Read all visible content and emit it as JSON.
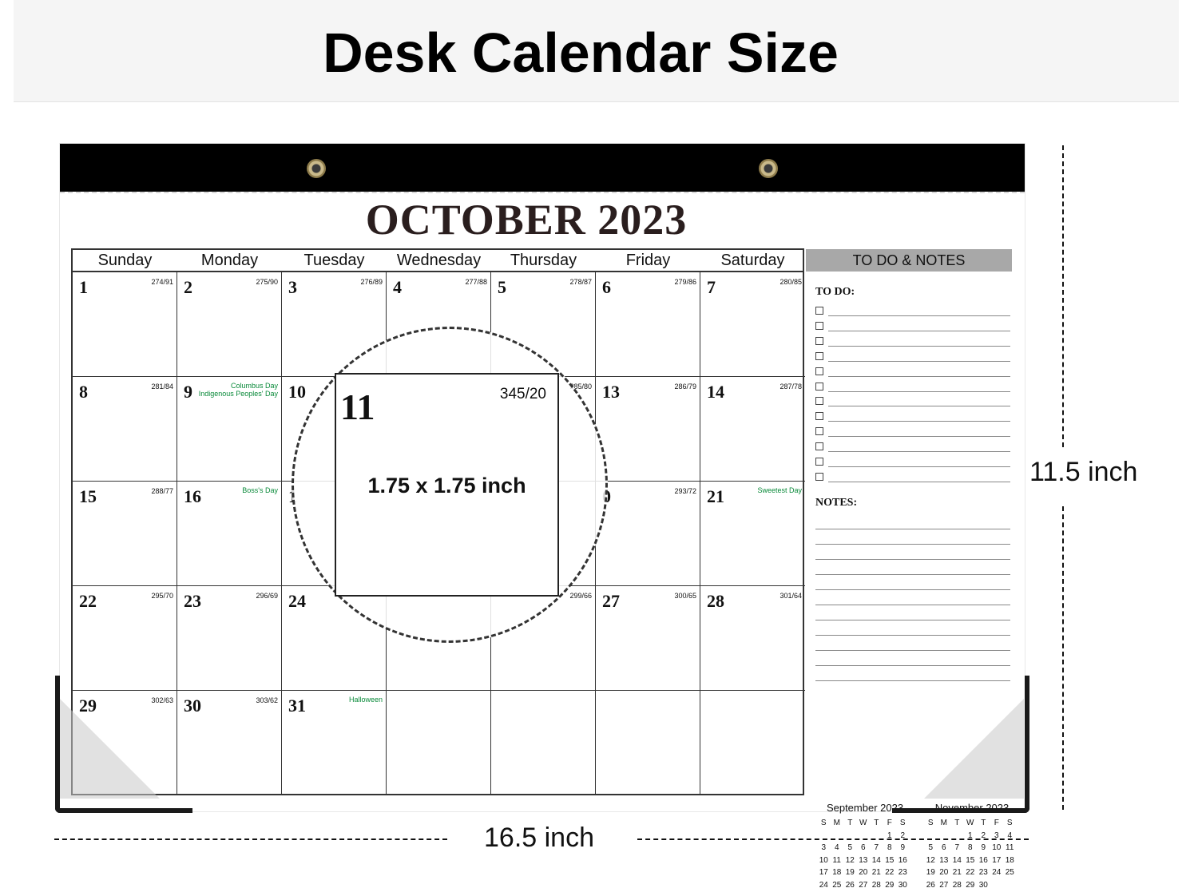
{
  "banner": {
    "title": "Desk Calendar Size"
  },
  "calendar": {
    "month_title": "OCTOBER 2023",
    "weekdays": [
      "Sunday",
      "Monday",
      "Tuesday",
      "Wednesday",
      "Thursday",
      "Friday",
      "Saturday"
    ],
    "cells": [
      {
        "num": "1",
        "dn": "274/91",
        "hol": ""
      },
      {
        "num": "2",
        "dn": "275/90",
        "hol": ""
      },
      {
        "num": "3",
        "dn": "276/89",
        "hol": ""
      },
      {
        "num": "4",
        "dn": "277/88",
        "hol": ""
      },
      {
        "num": "5",
        "dn": "278/87",
        "hol": ""
      },
      {
        "num": "6",
        "dn": "279/86",
        "hol": ""
      },
      {
        "num": "7",
        "dn": "280/85",
        "hol": ""
      },
      {
        "num": "8",
        "dn": "281/84",
        "hol": ""
      },
      {
        "num": "9",
        "dn": "",
        "hol": "Columbus Day\nIndigenous Peoples' Day"
      },
      {
        "num": "10",
        "dn": "",
        "hol": ""
      },
      {
        "num": "",
        "dn": "",
        "hol": ""
      },
      {
        "num": "",
        "dn": "285/80",
        "hol": ""
      },
      {
        "num": "13",
        "dn": "286/79",
        "hol": ""
      },
      {
        "num": "14",
        "dn": "287/78",
        "hol": ""
      },
      {
        "num": "15",
        "dn": "288/77",
        "hol": ""
      },
      {
        "num": "16",
        "dn": "",
        "hol": "Boss's Day"
      },
      {
        "num": "1",
        "dn": "",
        "hol": ""
      },
      {
        "num": "",
        "dn": "",
        "hol": ""
      },
      {
        "num": "",
        "dn": "",
        "hol": ""
      },
      {
        "num": "0",
        "dn": "293/72",
        "hol": ""
      },
      {
        "num": "21",
        "dn": "",
        "hol": "Sweetest Day"
      },
      {
        "num": "22",
        "dn": "295/70",
        "hol": ""
      },
      {
        "num": "23",
        "dn": "296/69",
        "hol": ""
      },
      {
        "num": "24",
        "dn": "",
        "hol": ""
      },
      {
        "num": "",
        "dn": "",
        "hol": ""
      },
      {
        "num": "",
        "dn": "299/66",
        "hol": ""
      },
      {
        "num": "27",
        "dn": "300/65",
        "hol": ""
      },
      {
        "num": "28",
        "dn": "301/64",
        "hol": ""
      },
      {
        "num": "29",
        "dn": "302/63",
        "hol": ""
      },
      {
        "num": "30",
        "dn": "303/62",
        "hol": ""
      },
      {
        "num": "31",
        "dn": "",
        "hol": "Halloween"
      },
      {
        "num": "",
        "dn": "",
        "hol": ""
      },
      {
        "num": "",
        "dn": "",
        "hol": ""
      },
      {
        "num": "",
        "dn": "",
        "hol": ""
      },
      {
        "num": "",
        "dn": "",
        "hol": ""
      }
    ],
    "zoom": {
      "num": "11",
      "dn": "345/20",
      "size_label": "1.75 x 1.75 inch"
    }
  },
  "notes_panel": {
    "header": "TO DO & NOTES",
    "todo_label": "TO DO:",
    "todo_count": 12,
    "notes_label": "NOTES:",
    "notes_lines": 11
  },
  "mini_calendars": [
    {
      "title": "September 2023",
      "rows": [
        [
          "S",
          "M",
          "T",
          "W",
          "T",
          "F",
          "S"
        ],
        [
          "",
          "",
          "",
          "",
          "",
          "1",
          "2"
        ],
        [
          "3",
          "4",
          "5",
          "6",
          "7",
          "8",
          "9"
        ],
        [
          "10",
          "11",
          "12",
          "13",
          "14",
          "15",
          "16"
        ],
        [
          "17",
          "18",
          "19",
          "20",
          "21",
          "22",
          "23"
        ],
        [
          "24",
          "25",
          "26",
          "27",
          "28",
          "29",
          "30"
        ]
      ]
    },
    {
      "title": "November 2023",
      "rows": [
        [
          "S",
          "M",
          "T",
          "W",
          "T",
          "F",
          "S"
        ],
        [
          "",
          "",
          "",
          "1",
          "2",
          "3",
          "4"
        ],
        [
          "5",
          "6",
          "7",
          "8",
          "9",
          "10",
          "11"
        ],
        [
          "12",
          "13",
          "14",
          "15",
          "16",
          "17",
          "18"
        ],
        [
          "19",
          "20",
          "21",
          "22",
          "23",
          "24",
          "25"
        ],
        [
          "26",
          "27",
          "28",
          "29",
          "30",
          "",
          ""
        ]
      ]
    }
  ],
  "dimensions": {
    "height_label": "11.5 inch",
    "width_label": "16.5 inch"
  }
}
